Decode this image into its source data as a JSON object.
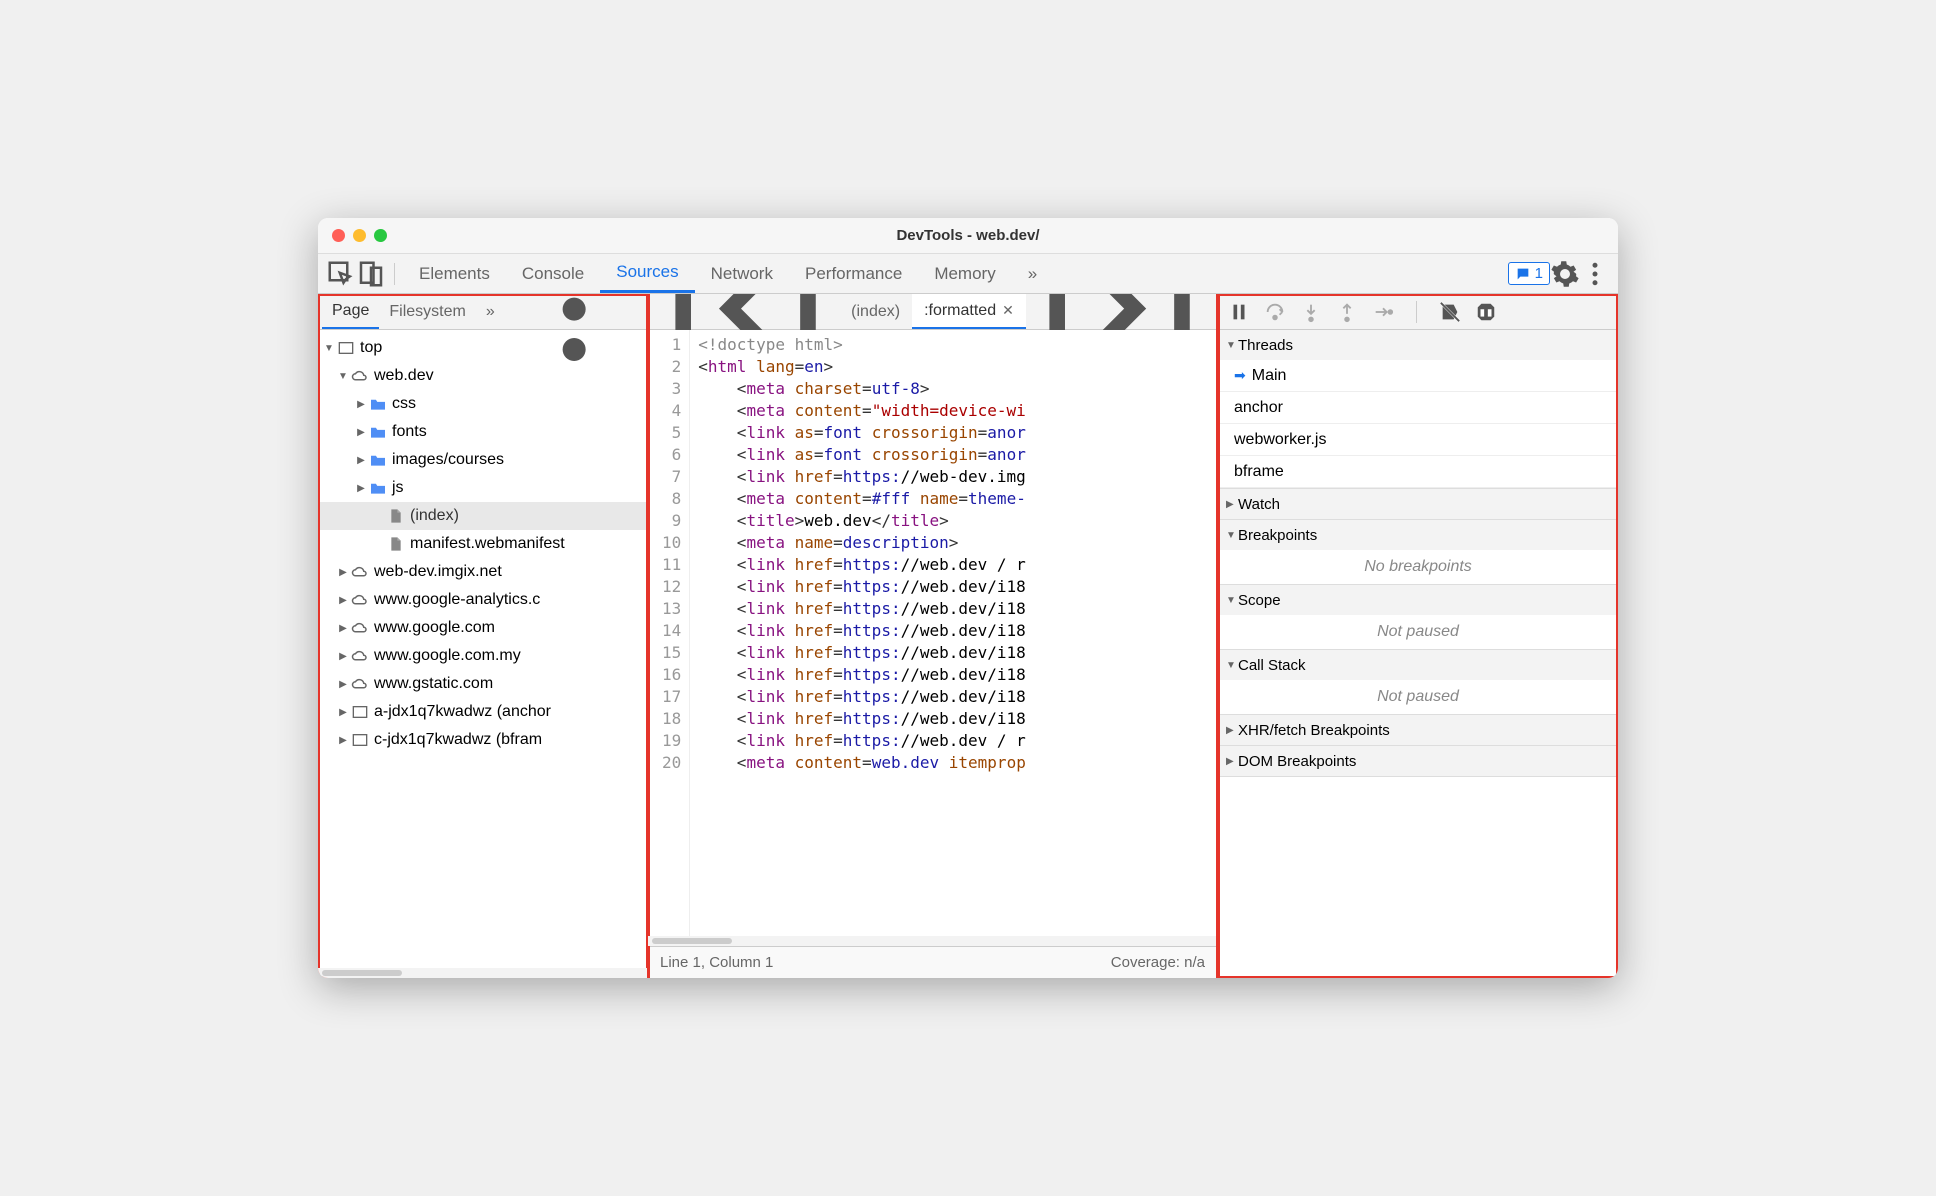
{
  "title": "DevTools - web.dev/",
  "main_tabs": {
    "items": [
      "Elements",
      "Console",
      "Sources",
      "Network",
      "Performance",
      "Memory"
    ],
    "active": "Sources",
    "overflow": "»",
    "badge_count": "1"
  },
  "sidebar": {
    "tabs": {
      "items": [
        "Page",
        "Filesystem"
      ],
      "active": "Page",
      "overflow": "»"
    },
    "tree": [
      {
        "label": "top",
        "icon": "frame",
        "depth": 0,
        "expanded": true
      },
      {
        "label": "web.dev",
        "icon": "cloud",
        "depth": 1,
        "expanded": true
      },
      {
        "label": "css",
        "icon": "folder",
        "depth": 2,
        "expanded": false
      },
      {
        "label": "fonts",
        "icon": "folder",
        "depth": 2,
        "expanded": false
      },
      {
        "label": "images/courses",
        "icon": "folder",
        "depth": 2,
        "expanded": false
      },
      {
        "label": "js",
        "icon": "folder",
        "depth": 2,
        "expanded": false
      },
      {
        "label": "(index)",
        "icon": "file",
        "depth": 3,
        "selected": true
      },
      {
        "label": "manifest.webmanifest",
        "icon": "file",
        "depth": 3
      },
      {
        "label": "web-dev.imgix.net",
        "icon": "cloud",
        "depth": 1,
        "expanded": false
      },
      {
        "label": "www.google-analytics.c",
        "icon": "cloud",
        "depth": 1,
        "expanded": false
      },
      {
        "label": "www.google.com",
        "icon": "cloud",
        "depth": 1,
        "expanded": false
      },
      {
        "label": "www.google.com.my",
        "icon": "cloud",
        "depth": 1,
        "expanded": false
      },
      {
        "label": "www.gstatic.com",
        "icon": "cloud",
        "depth": 1,
        "expanded": false
      },
      {
        "label": "a-jdx1q7kwadwz (anchor",
        "icon": "frame",
        "depth": 1,
        "expanded": false
      },
      {
        "label": "c-jdx1q7kwadwz (bfram",
        "icon": "frame",
        "depth": 1,
        "expanded": false
      }
    ]
  },
  "editor": {
    "tabs": [
      {
        "label": "(index)",
        "active": false,
        "close": false
      },
      {
        "label": ":formatted",
        "active": true,
        "close": true
      }
    ],
    "lines": [
      {
        "n": 1,
        "html": "<span class='tok-doctype'>&lt;!doctype html&gt;</span>"
      },
      {
        "n": 2,
        "html": "<span class='tok-punct'>&lt;</span><span class='tok-tag'>html</span> <span class='tok-attr'>lang</span><span class='tok-punct'>=</span><span class='tok-val'>en</span><span class='tok-punct'>&gt;</span>"
      },
      {
        "n": 3,
        "html": "    <span class='tok-punct'>&lt;</span><span class='tok-tag'>meta</span> <span class='tok-attr'>charset</span><span class='tok-punct'>=</span><span class='tok-val'>utf-8</span><span class='tok-punct'>&gt;</span>"
      },
      {
        "n": 4,
        "html": "    <span class='tok-punct'>&lt;</span><span class='tok-tag'>meta</span> <span class='tok-attr'>content</span><span class='tok-punct'>=</span><span class='tok-string'>\"width=device-wi</span>"
      },
      {
        "n": 5,
        "html": "    <span class='tok-punct'>&lt;</span><span class='tok-tag'>link</span> <span class='tok-attr'>as</span><span class='tok-punct'>=</span><span class='tok-val'>font</span> <span class='tok-attr'>crossorigin</span><span class='tok-punct'>=</span><span class='tok-val'>anor</span>"
      },
      {
        "n": 6,
        "html": "    <span class='tok-punct'>&lt;</span><span class='tok-tag'>link</span> <span class='tok-attr'>as</span><span class='tok-punct'>=</span><span class='tok-val'>font</span> <span class='tok-attr'>crossorigin</span><span class='tok-punct'>=</span><span class='tok-val'>anor</span>"
      },
      {
        "n": 7,
        "html": "    <span class='tok-punct'>&lt;</span><span class='tok-tag'>link</span> <span class='tok-attr'>href</span><span class='tok-punct'>=</span><span class='tok-val'>https:</span>//web-dev.img"
      },
      {
        "n": 8,
        "html": "    <span class='tok-punct'>&lt;</span><span class='tok-tag'>meta</span> <span class='tok-attr'>content</span><span class='tok-punct'>=</span><span class='tok-val'>#fff</span> <span class='tok-attr'>name</span><span class='tok-punct'>=</span><span class='tok-val'>theme-</span>"
      },
      {
        "n": 9,
        "html": "    <span class='tok-punct'>&lt;</span><span class='tok-tag'>title</span><span class='tok-punct'>&gt;</span>web.dev<span class='tok-punct'>&lt;/</span><span class='tok-tag'>title</span><span class='tok-punct'>&gt;</span>"
      },
      {
        "n": 10,
        "html": "    <span class='tok-punct'>&lt;</span><span class='tok-tag'>meta</span> <span class='tok-attr'>name</span><span class='tok-punct'>=</span><span class='tok-val'>description</span><span class='tok-punct'>&gt;</span>"
      },
      {
        "n": 11,
        "html": "    <span class='tok-punct'>&lt;</span><span class='tok-tag'>link</span> <span class='tok-attr'>href</span><span class='tok-punct'>=</span><span class='tok-val'>https:</span>//web.dev / r"
      },
      {
        "n": 12,
        "html": "    <span class='tok-punct'>&lt;</span><span class='tok-tag'>link</span> <span class='tok-attr'>href</span><span class='tok-punct'>=</span><span class='tok-val'>https:</span>//web.dev/i18"
      },
      {
        "n": 13,
        "html": "    <span class='tok-punct'>&lt;</span><span class='tok-tag'>link</span> <span class='tok-attr'>href</span><span class='tok-punct'>=</span><span class='tok-val'>https:</span>//web.dev/i18"
      },
      {
        "n": 14,
        "html": "    <span class='tok-punct'>&lt;</span><span class='tok-tag'>link</span> <span class='tok-attr'>href</span><span class='tok-punct'>=</span><span class='tok-val'>https:</span>//web.dev/i18"
      },
      {
        "n": 15,
        "html": "    <span class='tok-punct'>&lt;</span><span class='tok-tag'>link</span> <span class='tok-attr'>href</span><span class='tok-punct'>=</span><span class='tok-val'>https:</span>//web.dev/i18"
      },
      {
        "n": 16,
        "html": "    <span class='tok-punct'>&lt;</span><span class='tok-tag'>link</span> <span class='tok-attr'>href</span><span class='tok-punct'>=</span><span class='tok-val'>https:</span>//web.dev/i18"
      },
      {
        "n": 17,
        "html": "    <span class='tok-punct'>&lt;</span><span class='tok-tag'>link</span> <span class='tok-attr'>href</span><span class='tok-punct'>=</span><span class='tok-val'>https:</span>//web.dev/i18"
      },
      {
        "n": 18,
        "html": "    <span class='tok-punct'>&lt;</span><span class='tok-tag'>link</span> <span class='tok-attr'>href</span><span class='tok-punct'>=</span><span class='tok-val'>https:</span>//web.dev/i18"
      },
      {
        "n": 19,
        "html": "    <span class='tok-punct'>&lt;</span><span class='tok-tag'>link</span> <span class='tok-attr'>href</span><span class='tok-punct'>=</span><span class='tok-val'>https:</span>//web.dev / r"
      },
      {
        "n": 20,
        "html": "    <span class='tok-punct'>&lt;</span><span class='tok-tag'>meta</span> <span class='tok-attr'>content</span><span class='tok-punct'>=</span><span class='tok-val'>web.dev</span> <span class='tok-attr'>itemprop</span>"
      }
    ],
    "status_left": "Line 1, Column 1",
    "status_right": "Coverage: n/a"
  },
  "debugger": {
    "sections": [
      {
        "name": "Threads",
        "expanded": true,
        "items": [
          "Main",
          "anchor",
          "webworker.js",
          "bframe"
        ],
        "active_item": "Main"
      },
      {
        "name": "Watch",
        "expanded": false
      },
      {
        "name": "Breakpoints",
        "expanded": true,
        "empty": "No breakpoints"
      },
      {
        "name": "Scope",
        "expanded": true,
        "empty": "Not paused"
      },
      {
        "name": "Call Stack",
        "expanded": true,
        "empty": "Not paused"
      },
      {
        "name": "XHR/fetch Breakpoints",
        "expanded": false
      },
      {
        "name": "DOM Breakpoints",
        "expanded": false
      }
    ]
  }
}
